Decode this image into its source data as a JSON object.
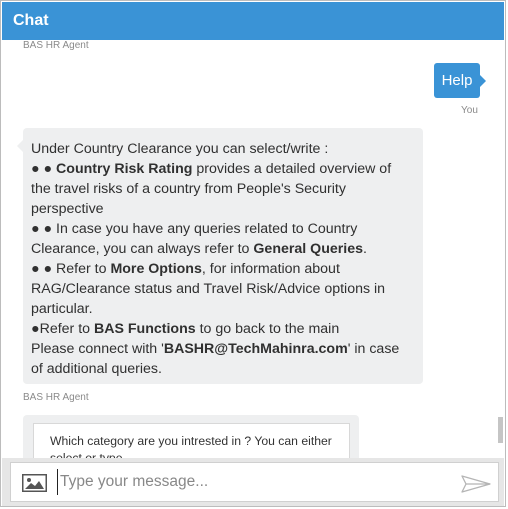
{
  "header": {
    "title": "Chat"
  },
  "messages": {
    "agent_label_1": "BAS HR Agent",
    "user_message": "Help",
    "you_label": "You",
    "bot_lines": [
      [
        {
          "t": "Under Country Clearance you can select/write :",
          "b": false
        }
      ],
      [
        {
          "t": "● ● ",
          "b": false
        },
        {
          "t": "Country Risk Rating",
          "b": true
        },
        {
          "t": " provides a detailed overview of",
          "b": false
        }
      ],
      [
        {
          "t": "the travel risks of a country from People's Security",
          "b": false
        }
      ],
      [
        {
          "t": "perspective",
          "b": false
        }
      ],
      [
        {
          "t": "● ● In case you have any queries related to Country",
          "b": false
        }
      ],
      [
        {
          "t": "Clearance, you can always refer to ",
          "b": false
        },
        {
          "t": "General Queries",
          "b": true
        },
        {
          "t": ".",
          "b": false
        }
      ],
      [
        {
          "t": "● ● Refer to ",
          "b": false
        },
        {
          "t": "More Options",
          "b": true
        },
        {
          "t": ", for information about",
          "b": false
        }
      ],
      [
        {
          "t": "RAG/Clearance status and Travel Risk/Advice options in",
          "b": false
        }
      ],
      [
        {
          "t": "particular.",
          "b": false
        }
      ],
      [
        {
          "t": "●Refer to ",
          "b": false
        },
        {
          "t": "BAS Functions",
          "b": true
        },
        {
          "t": " to go back to the main",
          "b": false
        }
      ],
      [
        {
          "t": "Please connect with '",
          "b": false
        },
        {
          "t": "BASHR@TechMahinra.com",
          "b": true
        },
        {
          "t": "' in case",
          "b": false
        }
      ],
      [
        {
          "t": "of additional queries.",
          "b": false
        }
      ]
    ],
    "agent_label_2": "BAS HR Agent",
    "card_text": "Which category are you intrested in ? You can either select or type"
  },
  "composer": {
    "placeholder": "Type your message...",
    "value": ""
  },
  "colors": {
    "accent": "#3a93d6",
    "bubble": "#eeeff0"
  },
  "icons": {
    "attach": "image-icon",
    "send": "send-icon"
  }
}
